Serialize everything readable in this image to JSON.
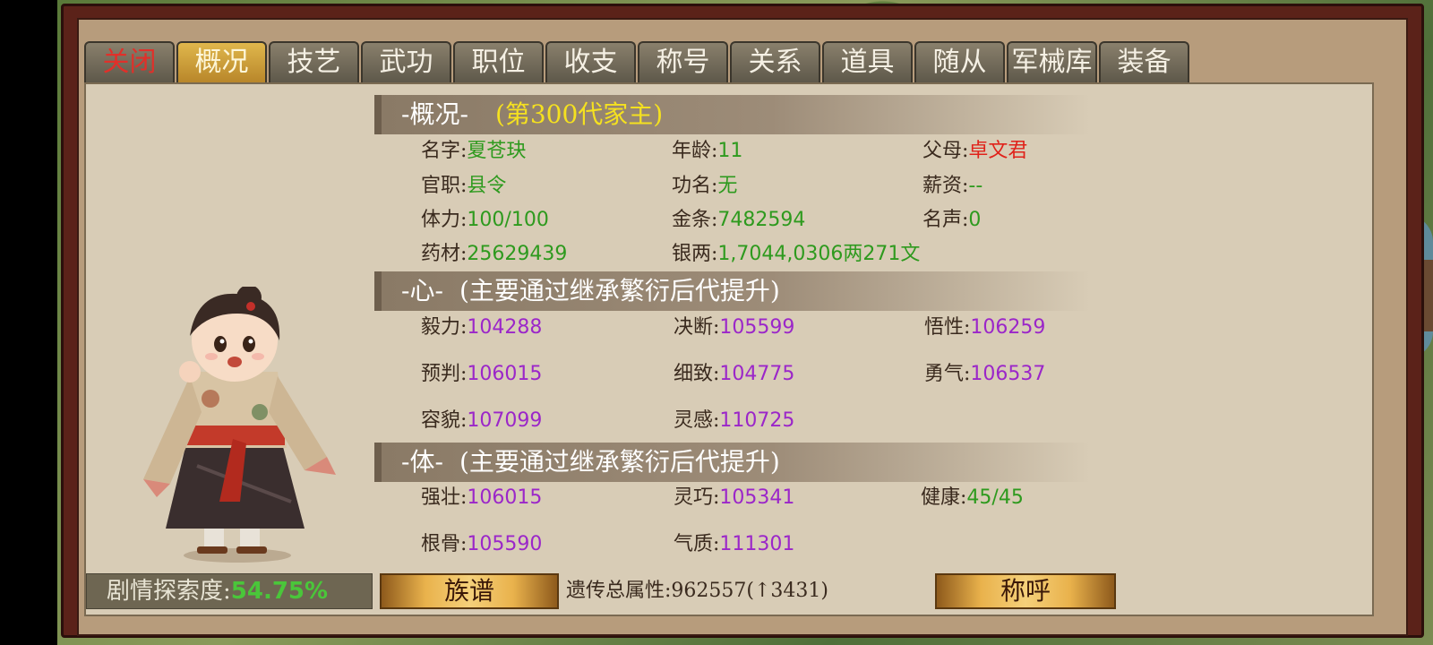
{
  "tabs": [
    "关闭",
    "概况",
    "技艺",
    "武功",
    "职位",
    "收支",
    "称号",
    "关系",
    "道具",
    "随从",
    "军械库",
    "装备"
  ],
  "active_tab": "概况",
  "overview": {
    "header": "-概况-",
    "header_sub": "(第300代家主)",
    "name_label": "名字:",
    "name": "夏苍玦",
    "age_label": "年龄:",
    "age": "11",
    "parents_label": "父母:",
    "parents": "卓文君",
    "office_label": "官职:",
    "office": "县令",
    "merit_label": "功名:",
    "merit": "无",
    "salary_label": "薪资:",
    "salary": "--",
    "stamina_label": "体力:",
    "stamina": "100/100",
    "gold_label": "金条:",
    "gold": "7482594",
    "fame_label": "名声:",
    "fame": "0",
    "herbs_label": "药材:",
    "herbs": "25629439",
    "silver_label": "银两:",
    "silver": "1,7044,0306两271文"
  },
  "mind": {
    "header": "-心-",
    "header_sub": "(主要通过继承繁衍后代提升)",
    "perseverance_label": "毅力:",
    "perseverance": "104288",
    "decisiveness_label": "决断:",
    "decisiveness": "105599",
    "insight_label": "悟性:",
    "insight": "106259",
    "foresight_label": "预判:",
    "foresight": "106015",
    "meticulous_label": "细致:",
    "meticulous": "104775",
    "courage_label": "勇气:",
    "courage": "106537",
    "appearance_label": "容貌:",
    "appearance": "107099",
    "inspiration_label": "灵感:",
    "inspiration": "110725"
  },
  "body": {
    "header": "-体-",
    "header_sub": "(主要通过继承繁衍后代提升)",
    "strength_label": "强壮:",
    "strength": "106015",
    "agility_label": "灵巧:",
    "agility": "105341",
    "health_label": "健康:",
    "health": "45/45",
    "bone_label": "根骨:",
    "bone": "105590",
    "temperament_label": "气质:",
    "temperament": "111301"
  },
  "footer": {
    "progress_label": "剧情探索度:",
    "progress_value": "54.75%",
    "genealogy_button": "族谱",
    "inherit_total": "遗传总属性:962557(↑3431)",
    "title_button": "称呼"
  },
  "colors": {
    "green": "#2e9a1e",
    "red": "#e0221a",
    "purple": "#9b26c9",
    "yellow": "#f5e11f",
    "active_tab": "#e0b74c"
  }
}
